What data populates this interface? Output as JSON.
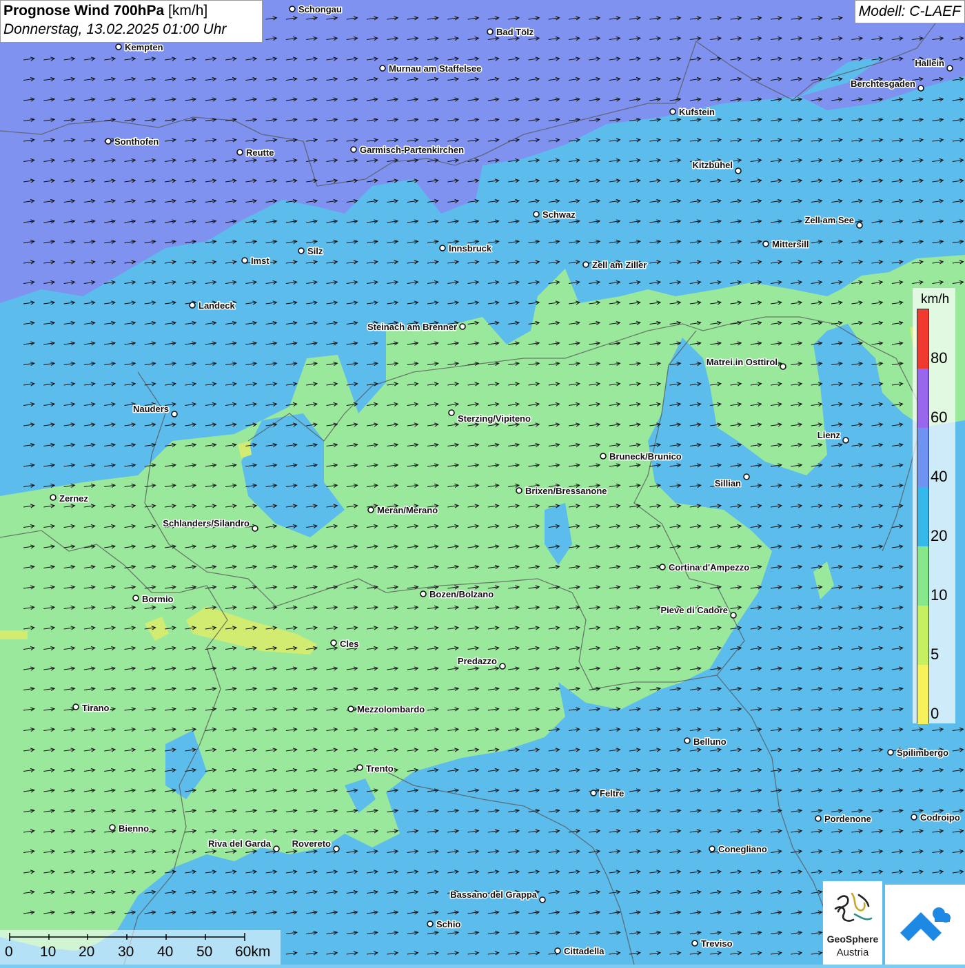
{
  "title": {
    "main": "Prognose Wind 700hPa",
    "unit": "[km/h]",
    "datetime": "Donnerstag, 13.02.2025 01:00 Uhr",
    "model": "Modell: C-LAEF"
  },
  "legend": {
    "unit": "km/h",
    "ticks": [
      "80",
      "60",
      "40",
      "20",
      "10",
      "5",
      "0"
    ],
    "colors": [
      "#f03a30",
      "#9966ee",
      "#6e93f0",
      "#35b8ea",
      "#86e88a",
      "#c6f060",
      "#f7f25a"
    ]
  },
  "scale": {
    "labels": [
      "0",
      "10",
      "20",
      "30",
      "40",
      "50",
      "60km"
    ]
  },
  "cities": [
    {
      "name": "Schongau"
    },
    {
      "name": "Bad Tölz"
    },
    {
      "name": "Kempten"
    },
    {
      "name": "Murnau am Staffelsee"
    },
    {
      "name": "Hallein"
    },
    {
      "name": "Berchtesgaden"
    },
    {
      "name": "Kufstein"
    },
    {
      "name": "Sonthofen"
    },
    {
      "name": "Reutte"
    },
    {
      "name": "Garmisch-Partenkirchen"
    },
    {
      "name": "Kitzbühel"
    },
    {
      "name": "Schwaz"
    },
    {
      "name": "Zell am See"
    },
    {
      "name": "Mittersill"
    },
    {
      "name": "Innsbruck"
    },
    {
      "name": "Silz"
    },
    {
      "name": "Imst"
    },
    {
      "name": "Zell am Ziller"
    },
    {
      "name": "Landeck"
    },
    {
      "name": "Steinach am Brenner"
    },
    {
      "name": "Matrei in Osttirol"
    },
    {
      "name": "Nauders"
    },
    {
      "name": "Sterzing/Vipiteno"
    },
    {
      "name": "Lienz"
    },
    {
      "name": "Bruneck/Brunico"
    },
    {
      "name": "Sillian"
    },
    {
      "name": "Zernez"
    },
    {
      "name": "Brixen/Bressanone"
    },
    {
      "name": "Meran/Merano"
    },
    {
      "name": "Schlanders/Silandro"
    },
    {
      "name": "Cortina d'Ampezzo"
    },
    {
      "name": "Bozen/Bolzano"
    },
    {
      "name": "Bormio"
    },
    {
      "name": "Pieve di Cadore"
    },
    {
      "name": "Cles"
    },
    {
      "name": "Predazzo"
    },
    {
      "name": "Tirano"
    },
    {
      "name": "Mezzolombardo"
    },
    {
      "name": "Belluno"
    },
    {
      "name": "Spilimbergo"
    },
    {
      "name": "Trento"
    },
    {
      "name": "Feltre"
    },
    {
      "name": "Pordenone"
    },
    {
      "name": "Codroipo"
    },
    {
      "name": "Bienno"
    },
    {
      "name": "Riva del Garda"
    },
    {
      "name": "Rovereto"
    },
    {
      "name": "Conegliano"
    },
    {
      "name": "Bassano del Grappa"
    },
    {
      "name": "Schio"
    },
    {
      "name": "Treviso"
    },
    {
      "name": "Cittadella"
    }
  ],
  "logo": {
    "name": "GeoSphere",
    "sub": "Austria"
  },
  "colors": {
    "purple_zone": "#7e8ef0",
    "blue_zone": "#5ab9ec",
    "green_zone": "#9ae89a",
    "yellow_zone": "#d8ec6e"
  }
}
